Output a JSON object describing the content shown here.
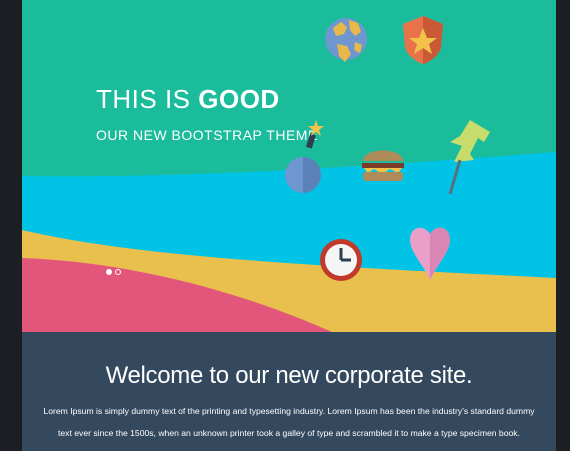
{
  "hero": {
    "title_part1": "THIS IS ",
    "title_bold": "GOOD",
    "subtitle": "OUR NEW BOOTSTRAP THEME",
    "slides_total": 2,
    "slide_active": 1,
    "colors": {
      "teal": "#1abc9c",
      "cyan": "#00c3e6",
      "yellow": "#e9bf4e",
      "pink": "#e1567a"
    },
    "icons": [
      "globe-icon",
      "shield-star-icon",
      "bomb-icon",
      "burger-icon",
      "pushpin-icon",
      "clock-icon",
      "heart-icon"
    ]
  },
  "welcome": {
    "heading": "Welcome to our new corporate site.",
    "body": "Lorem Ipsum is simply dummy text of the printing and typesetting industry. Lorem Ipsum has been the industry's standard dummy text ever since the 1500s, when an unknown printer took a galley of type and scrambled it to make a type specimen book.",
    "background": "#34495e"
  }
}
